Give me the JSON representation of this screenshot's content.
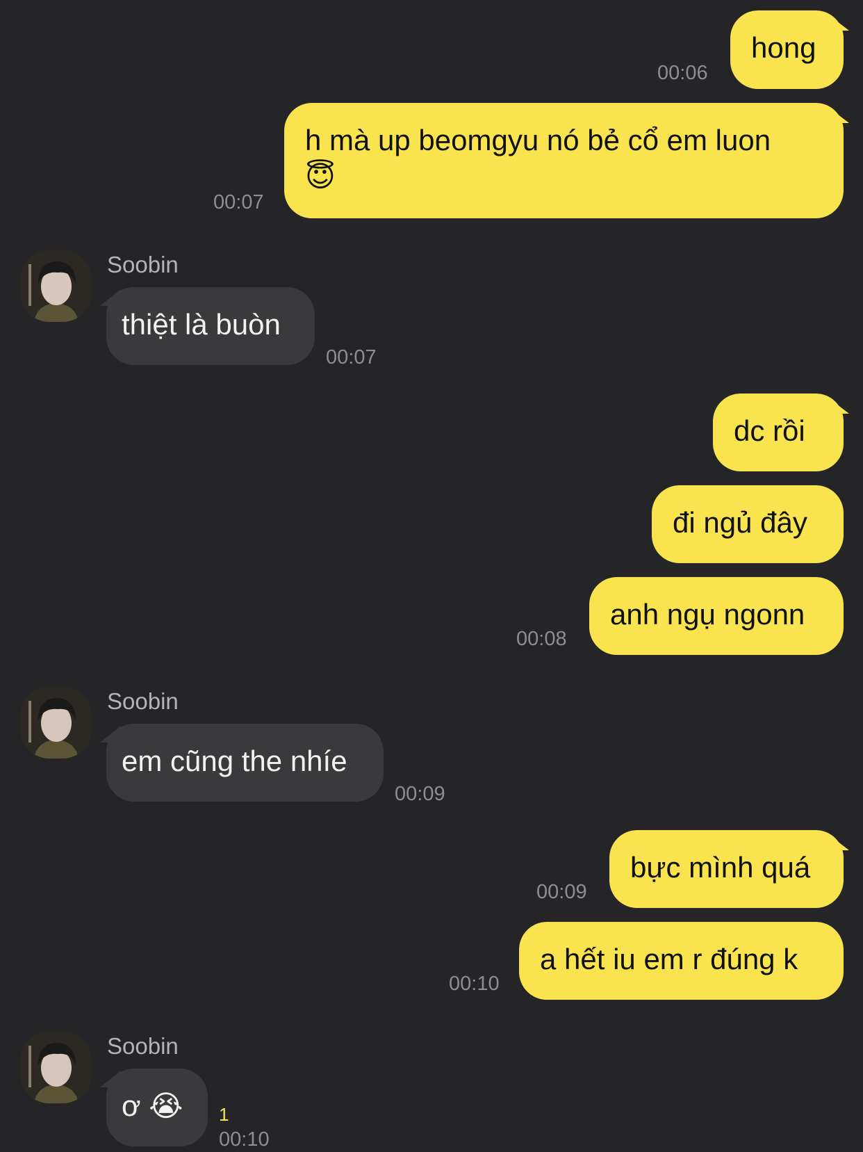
{
  "contact": {
    "name": "Soobin"
  },
  "messages": [
    {
      "side": "out",
      "text": "hong",
      "time": "00:06"
    },
    {
      "side": "out",
      "text": "h mà up beomgyu nó bẻ cổ em luon",
      "emoji": "😇",
      "time": "00:07"
    },
    {
      "side": "in",
      "sender": "Soobin",
      "text": "thiệt là buòn",
      "time": "00:07"
    },
    {
      "side": "out",
      "text": "dc rồi"
    },
    {
      "side": "out",
      "text": "đi ngủ đây"
    },
    {
      "side": "out",
      "text": "anh ngụ ngonn",
      "time": "00:08"
    },
    {
      "side": "in",
      "sender": "Soobin",
      "text": "em cũng the nhíe",
      "time": "00:09"
    },
    {
      "side": "out",
      "text": "bực mình quá",
      "time": "00:09"
    },
    {
      "side": "out",
      "text": "a hết iu em r đúng k",
      "time": "00:10"
    },
    {
      "side": "in",
      "sender": "Soobin",
      "text": "ơ",
      "emoji": "😭",
      "time": "00:10",
      "unread": "1"
    }
  ],
  "colors": {
    "background": "#252527",
    "outgoing_bubble": "#f9e44f",
    "incoming_bubble": "#3a3a3c",
    "timestamp": "#8d8d92",
    "unread_count": "#f9e44f"
  },
  "icons": {
    "avatar": "profile-photo"
  }
}
